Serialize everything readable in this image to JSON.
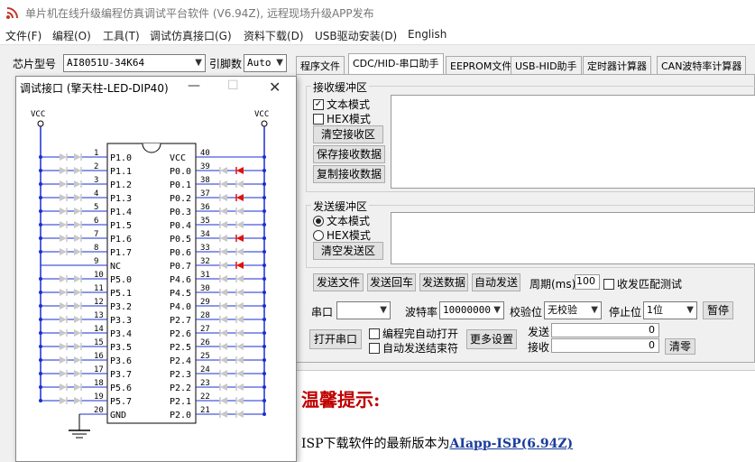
{
  "window": {
    "title": "单片机在线升级编程仿真调试平台软件 (V6.94Z), 远程现场升级APP发布"
  },
  "menu": [
    "文件(F)",
    "编程(O)",
    "工具(T)",
    "调试仿真接口(G)",
    "资料下载(D)",
    "USB驱动安装(D)",
    "English"
  ],
  "toolbar": {
    "chip_label": "芯片型号",
    "chip_value": "AI8051U-34K64",
    "pin_label": "引脚数",
    "pin_value": "Auto"
  },
  "tabs": [
    "程序文件",
    "CDC/HID-串口助手",
    "EEPROM文件",
    "USB-HID助手",
    "定时器计算器",
    "CAN波特率计算器"
  ],
  "receive": {
    "group_title": "接收缓冲区",
    "text_mode": "文本模式",
    "hex_mode": "HEX模式",
    "clear": "清空接收区",
    "save": "保存接收数据",
    "copy": "复制接收数据"
  },
  "send": {
    "group_title": "发送缓冲区",
    "text_mode": "文本模式",
    "hex_mode": "HEX模式",
    "clear": "清空发送区"
  },
  "send_row": {
    "send_file": "发送文件",
    "send_echo": "发送回车",
    "send_data": "发送数据",
    "auto_send": "自动发送",
    "period_label": "周期(ms)",
    "period_value": "100",
    "match_test": "收发匹配测试"
  },
  "serial": {
    "port_label": "串口",
    "baud_label": "波特率",
    "baud_value": "10000000",
    "parity_label": "校验位",
    "parity_value": "无校验",
    "stop_label": "停止位",
    "stop_value": "1位",
    "pause": "暂停",
    "open": "打开串口",
    "auto_open": "编程完自动打开",
    "auto_end": "自动发送结束符",
    "more": "更多设置",
    "send_count_label": "发送",
    "send_count": "0",
    "recv_count_label": "接收",
    "recv_count": "0",
    "clear_count": "清零"
  },
  "tip": {
    "title": "温馨提示:",
    "text": "ISP下载软件的最新版本为",
    "link": "AIapp-ISP(6.94Z)"
  },
  "chip_window": {
    "title": "调试接口 (擎天柱-LED-DIP40)",
    "vcc_left": "VCC",
    "vcc_right": "VCC",
    "left_pins": [
      {
        "num": "1",
        "name": "P1.0"
      },
      {
        "num": "2",
        "name": "P1.1"
      },
      {
        "num": "3",
        "name": "P1.2"
      },
      {
        "num": "4",
        "name": "P1.3"
      },
      {
        "num": "5",
        "name": "P1.4"
      },
      {
        "num": "6",
        "name": "P1.5"
      },
      {
        "num": "7",
        "name": "P1.6"
      },
      {
        "num": "8",
        "name": "P1.7"
      },
      {
        "num": "9",
        "name": "NC"
      },
      {
        "num": "10",
        "name": "P5.0"
      },
      {
        "num": "11",
        "name": "P5.1"
      },
      {
        "num": "12",
        "name": "P3.2"
      },
      {
        "num": "13",
        "name": "P3.3"
      },
      {
        "num": "14",
        "name": "P3.4"
      },
      {
        "num": "15",
        "name": "P3.5"
      },
      {
        "num": "16",
        "name": "P3.6"
      },
      {
        "num": "17",
        "name": "P3.7"
      },
      {
        "num": "18",
        "name": "P5.6"
      },
      {
        "num": "19",
        "name": "P5.7"
      },
      {
        "num": "20",
        "name": "GND"
      }
    ],
    "right_pins": [
      {
        "num": "40",
        "name": "VCC"
      },
      {
        "num": "39",
        "name": "P0.0"
      },
      {
        "num": "38",
        "name": "P0.1"
      },
      {
        "num": "37",
        "name": "P0.2"
      },
      {
        "num": "36",
        "name": "P0.3"
      },
      {
        "num": "35",
        "name": "P0.4"
      },
      {
        "num": "34",
        "name": "P0.5"
      },
      {
        "num": "33",
        "name": "P0.6"
      },
      {
        "num": "32",
        "name": "P0.7"
      },
      {
        "num": "31",
        "name": "P4.6"
      },
      {
        "num": "30",
        "name": "P4.5"
      },
      {
        "num": "29",
        "name": "P4.0"
      },
      {
        "num": "28",
        "name": "P2.7"
      },
      {
        "num": "27",
        "name": "P2.6"
      },
      {
        "num": "26",
        "name": "P2.5"
      },
      {
        "num": "25",
        "name": "P2.4"
      },
      {
        "num": "24",
        "name": "P2.3"
      },
      {
        "num": "23",
        "name": "P2.2"
      },
      {
        "num": "22",
        "name": "P2.1"
      },
      {
        "num": "21",
        "name": "P2.0"
      }
    ],
    "lit_leds_right": [
      "39",
      "37",
      "34",
      "32"
    ],
    "led_on_color": "#e01010",
    "led_off_color": "#c8c8c8",
    "wire_color": "#1a2fd0"
  }
}
